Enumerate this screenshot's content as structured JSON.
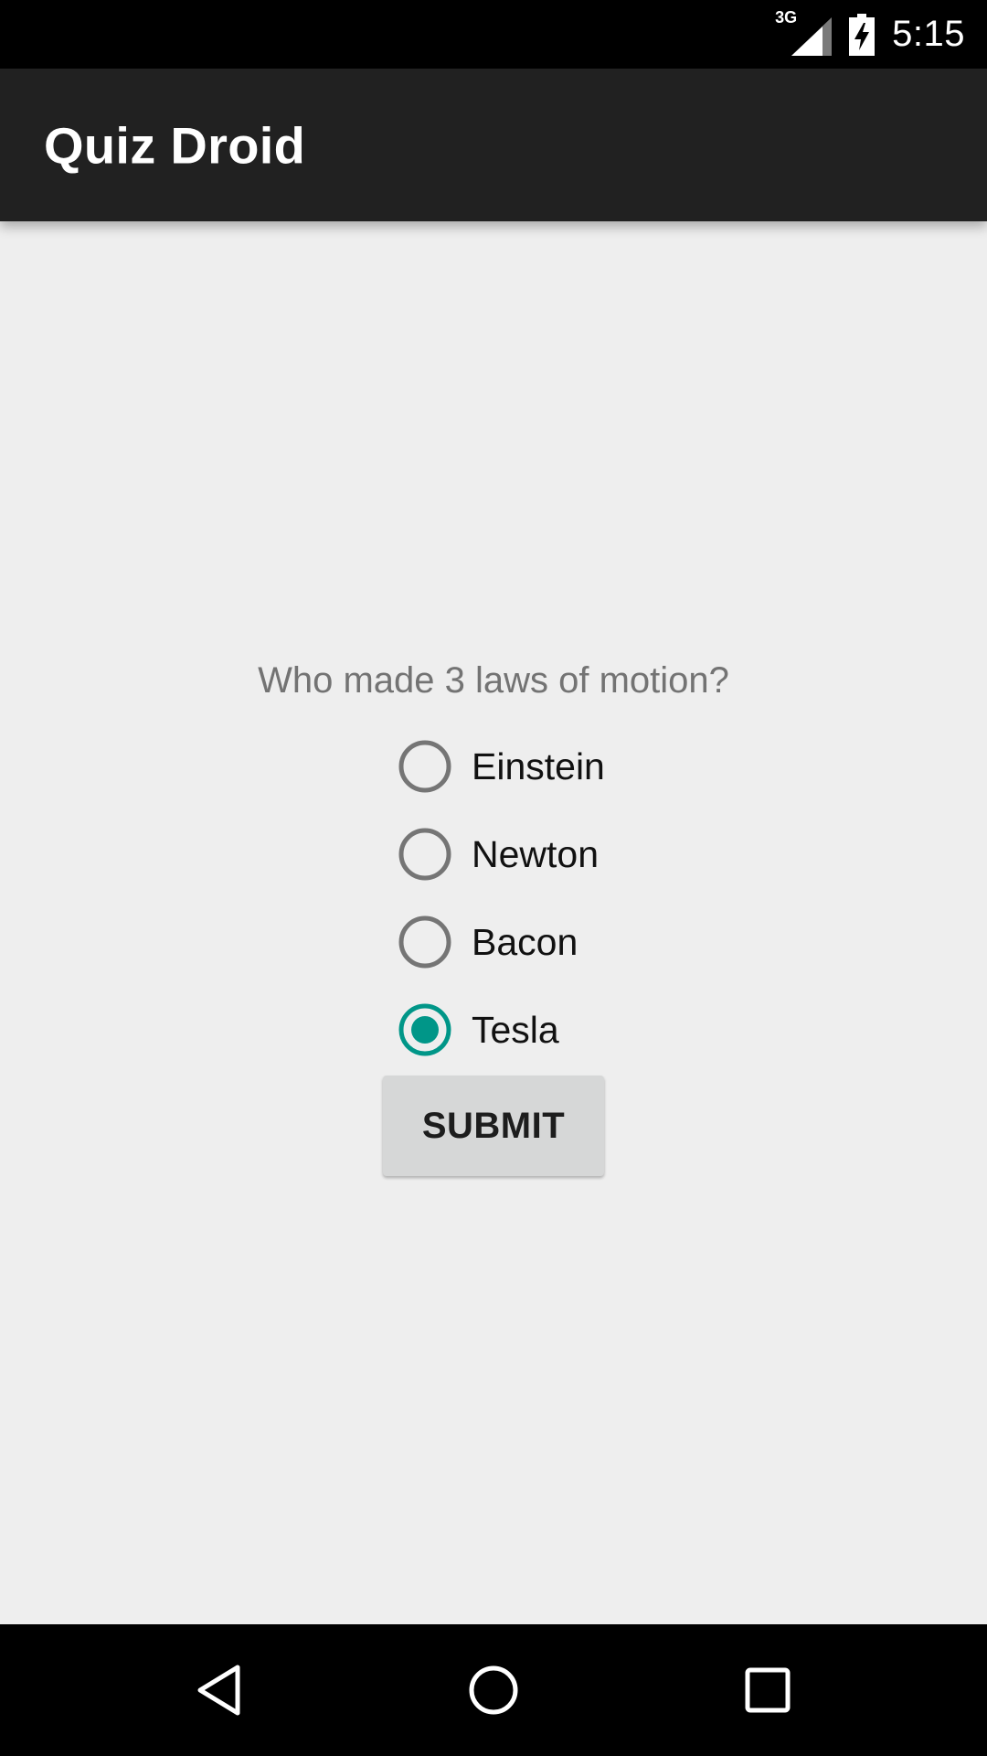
{
  "status_bar": {
    "network_label": "3G",
    "time": "5:15",
    "icons": [
      "cellular-signal-icon",
      "battery-charging-icon"
    ]
  },
  "app_bar": {
    "title": "Quiz Droid"
  },
  "quiz": {
    "question": "Who made 3 laws of motion?",
    "options": [
      {
        "label": "Einstein",
        "selected": false
      },
      {
        "label": "Newton",
        "selected": false
      },
      {
        "label": "Bacon",
        "selected": false
      },
      {
        "label": "Tesla",
        "selected": true
      }
    ],
    "submit_label": "SUBMIT"
  },
  "nav_bar": {
    "icons": [
      "back-icon",
      "home-icon",
      "recents-icon"
    ]
  },
  "colors": {
    "accent": "#009688",
    "radio_unchecked": "#757575",
    "app_bar": "#212121",
    "background": "#eeeeee"
  }
}
